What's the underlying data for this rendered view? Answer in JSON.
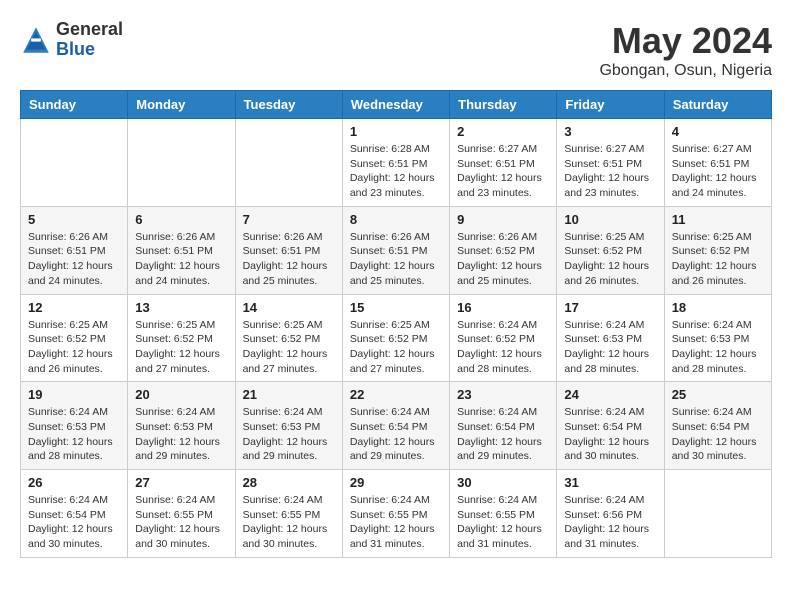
{
  "header": {
    "logo_general": "General",
    "logo_blue": "Blue",
    "month_title": "May 2024",
    "location": "Gbongan, Osun, Nigeria"
  },
  "days_of_week": [
    "Sunday",
    "Monday",
    "Tuesday",
    "Wednesday",
    "Thursday",
    "Friday",
    "Saturday"
  ],
  "weeks": [
    [
      {
        "day": "",
        "sunrise": "",
        "sunset": "",
        "daylight": ""
      },
      {
        "day": "",
        "sunrise": "",
        "sunset": "",
        "daylight": ""
      },
      {
        "day": "",
        "sunrise": "",
        "sunset": "",
        "daylight": ""
      },
      {
        "day": "1",
        "sunrise": "Sunrise: 6:28 AM",
        "sunset": "Sunset: 6:51 PM",
        "daylight": "Daylight: 12 hours and 23 minutes."
      },
      {
        "day": "2",
        "sunrise": "Sunrise: 6:27 AM",
        "sunset": "Sunset: 6:51 PM",
        "daylight": "Daylight: 12 hours and 23 minutes."
      },
      {
        "day": "3",
        "sunrise": "Sunrise: 6:27 AM",
        "sunset": "Sunset: 6:51 PM",
        "daylight": "Daylight: 12 hours and 23 minutes."
      },
      {
        "day": "4",
        "sunrise": "Sunrise: 6:27 AM",
        "sunset": "Sunset: 6:51 PM",
        "daylight": "Daylight: 12 hours and 24 minutes."
      }
    ],
    [
      {
        "day": "5",
        "sunrise": "Sunrise: 6:26 AM",
        "sunset": "Sunset: 6:51 PM",
        "daylight": "Daylight: 12 hours and 24 minutes."
      },
      {
        "day": "6",
        "sunrise": "Sunrise: 6:26 AM",
        "sunset": "Sunset: 6:51 PM",
        "daylight": "Daylight: 12 hours and 24 minutes."
      },
      {
        "day": "7",
        "sunrise": "Sunrise: 6:26 AM",
        "sunset": "Sunset: 6:51 PM",
        "daylight": "Daylight: 12 hours and 25 minutes."
      },
      {
        "day": "8",
        "sunrise": "Sunrise: 6:26 AM",
        "sunset": "Sunset: 6:51 PM",
        "daylight": "Daylight: 12 hours and 25 minutes."
      },
      {
        "day": "9",
        "sunrise": "Sunrise: 6:26 AM",
        "sunset": "Sunset: 6:52 PM",
        "daylight": "Daylight: 12 hours and 25 minutes."
      },
      {
        "day": "10",
        "sunrise": "Sunrise: 6:25 AM",
        "sunset": "Sunset: 6:52 PM",
        "daylight": "Daylight: 12 hours and 26 minutes."
      },
      {
        "day": "11",
        "sunrise": "Sunrise: 6:25 AM",
        "sunset": "Sunset: 6:52 PM",
        "daylight": "Daylight: 12 hours and 26 minutes."
      }
    ],
    [
      {
        "day": "12",
        "sunrise": "Sunrise: 6:25 AM",
        "sunset": "Sunset: 6:52 PM",
        "daylight": "Daylight: 12 hours and 26 minutes."
      },
      {
        "day": "13",
        "sunrise": "Sunrise: 6:25 AM",
        "sunset": "Sunset: 6:52 PM",
        "daylight": "Daylight: 12 hours and 27 minutes."
      },
      {
        "day": "14",
        "sunrise": "Sunrise: 6:25 AM",
        "sunset": "Sunset: 6:52 PM",
        "daylight": "Daylight: 12 hours and 27 minutes."
      },
      {
        "day": "15",
        "sunrise": "Sunrise: 6:25 AM",
        "sunset": "Sunset: 6:52 PM",
        "daylight": "Daylight: 12 hours and 27 minutes."
      },
      {
        "day": "16",
        "sunrise": "Sunrise: 6:24 AM",
        "sunset": "Sunset: 6:52 PM",
        "daylight": "Daylight: 12 hours and 28 minutes."
      },
      {
        "day": "17",
        "sunrise": "Sunrise: 6:24 AM",
        "sunset": "Sunset: 6:53 PM",
        "daylight": "Daylight: 12 hours and 28 minutes."
      },
      {
        "day": "18",
        "sunrise": "Sunrise: 6:24 AM",
        "sunset": "Sunset: 6:53 PM",
        "daylight": "Daylight: 12 hours and 28 minutes."
      }
    ],
    [
      {
        "day": "19",
        "sunrise": "Sunrise: 6:24 AM",
        "sunset": "Sunset: 6:53 PM",
        "daylight": "Daylight: 12 hours and 28 minutes."
      },
      {
        "day": "20",
        "sunrise": "Sunrise: 6:24 AM",
        "sunset": "Sunset: 6:53 PM",
        "daylight": "Daylight: 12 hours and 29 minutes."
      },
      {
        "day": "21",
        "sunrise": "Sunrise: 6:24 AM",
        "sunset": "Sunset: 6:53 PM",
        "daylight": "Daylight: 12 hours and 29 minutes."
      },
      {
        "day": "22",
        "sunrise": "Sunrise: 6:24 AM",
        "sunset": "Sunset: 6:54 PM",
        "daylight": "Daylight: 12 hours and 29 minutes."
      },
      {
        "day": "23",
        "sunrise": "Sunrise: 6:24 AM",
        "sunset": "Sunset: 6:54 PM",
        "daylight": "Daylight: 12 hours and 29 minutes."
      },
      {
        "day": "24",
        "sunrise": "Sunrise: 6:24 AM",
        "sunset": "Sunset: 6:54 PM",
        "daylight": "Daylight: 12 hours and 30 minutes."
      },
      {
        "day": "25",
        "sunrise": "Sunrise: 6:24 AM",
        "sunset": "Sunset: 6:54 PM",
        "daylight": "Daylight: 12 hours and 30 minutes."
      }
    ],
    [
      {
        "day": "26",
        "sunrise": "Sunrise: 6:24 AM",
        "sunset": "Sunset: 6:54 PM",
        "daylight": "Daylight: 12 hours and 30 minutes."
      },
      {
        "day": "27",
        "sunrise": "Sunrise: 6:24 AM",
        "sunset": "Sunset: 6:55 PM",
        "daylight": "Daylight: 12 hours and 30 minutes."
      },
      {
        "day": "28",
        "sunrise": "Sunrise: 6:24 AM",
        "sunset": "Sunset: 6:55 PM",
        "daylight": "Daylight: 12 hours and 30 minutes."
      },
      {
        "day": "29",
        "sunrise": "Sunrise: 6:24 AM",
        "sunset": "Sunset: 6:55 PM",
        "daylight": "Daylight: 12 hours and 31 minutes."
      },
      {
        "day": "30",
        "sunrise": "Sunrise: 6:24 AM",
        "sunset": "Sunset: 6:55 PM",
        "daylight": "Daylight: 12 hours and 31 minutes."
      },
      {
        "day": "31",
        "sunrise": "Sunrise: 6:24 AM",
        "sunset": "Sunset: 6:56 PM",
        "daylight": "Daylight: 12 hours and 31 minutes."
      },
      {
        "day": "",
        "sunrise": "",
        "sunset": "",
        "daylight": ""
      }
    ]
  ]
}
